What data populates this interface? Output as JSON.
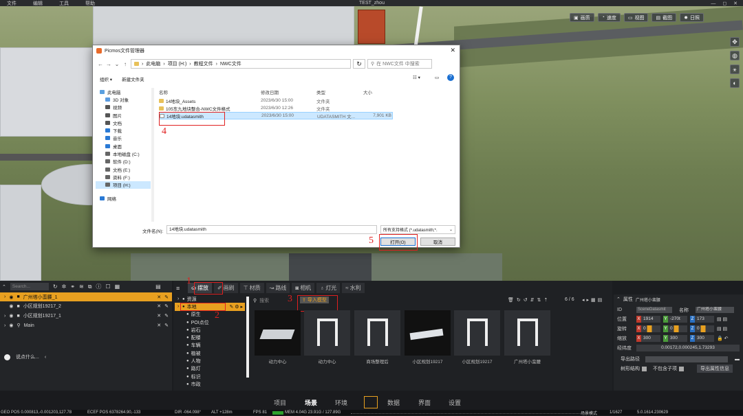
{
  "app": {
    "title": "TEST_zhou",
    "menu": [
      "文件",
      "编辑",
      "工具",
      "帮助"
    ]
  },
  "viewport": {
    "buttons": [
      "画质",
      "速度",
      "视图",
      "截图",
      "日照"
    ]
  },
  "dialog": {
    "title": "Picmos文件管理器",
    "path": [
      "此电脑",
      "项目 (H:)",
      "教程文件",
      "NWC文件"
    ],
    "search_placeholder": "在 NWC文件 中搜索",
    "organize": "组织 ▾",
    "new_folder": "新建文件夹",
    "nav": [
      {
        "label": "此电脑",
        "icon": "computer-icon"
      },
      {
        "label": "3D 对象",
        "icon": "cube-icon"
      },
      {
        "label": "视频",
        "icon": "video-icon"
      },
      {
        "label": "图片",
        "icon": "image-icon"
      },
      {
        "label": "文档",
        "icon": "document-icon"
      },
      {
        "label": "下载",
        "icon": "download-icon"
      },
      {
        "label": "音乐",
        "icon": "music-icon"
      },
      {
        "label": "桌面",
        "icon": "desktop-icon"
      },
      {
        "label": "本地磁盘 (C:)",
        "icon": "drive-icon"
      },
      {
        "label": "软件 (D:)",
        "icon": "drive-icon"
      },
      {
        "label": "文档 (E:)",
        "icon": "drive-icon"
      },
      {
        "label": "资料 (F:)",
        "icon": "drive-icon"
      },
      {
        "label": "项目 (H:)",
        "icon": "drive-icon"
      },
      {
        "label": "网络",
        "icon": "network-icon"
      }
    ],
    "columns": [
      "名称",
      "修改日期",
      "类型",
      "大小"
    ],
    "files": [
      {
        "name": "14地块_Assets",
        "date": "2023/6/30 15:00",
        "type": "文件夹",
        "size": "",
        "icon": "folder-icon"
      },
      {
        "name": "105东九地块整合-NWC文件格式",
        "date": "2023/6/30 12:26",
        "type": "文件夹",
        "size": "",
        "icon": "folder-icon"
      },
      {
        "name": "14地块.udatasmith",
        "date": "2023/6/30 15:00",
        "type": "UDATASMITH 文...",
        "size": "7,901 KB",
        "icon": "file-icon"
      }
    ],
    "filename_label": "文件名(N):",
    "filename_value": "14地块.udatasmith",
    "filetype": "所有支持格式 (*.udatasmith;*.",
    "open": "打开(O)",
    "cancel": "取消"
  },
  "annotations": [
    "1",
    "2",
    "3",
    "4",
    "5"
  ],
  "outliner": {
    "search_placeholder": "Search...",
    "items": [
      "广州塔小蛮腰_1",
      "小区规划19217_2",
      "小区规划19217_1",
      "Main"
    ],
    "chat": "说点什么..."
  },
  "tabs": [
    "摆放",
    "画刷",
    "材质",
    "路线",
    "相机",
    "灯光",
    "水利"
  ],
  "lib_tree": [
    "资源",
    "本地",
    "原生",
    "POI点位",
    "岩石",
    "配楼",
    "车辆",
    "植被",
    "人物",
    "路灯",
    "标识",
    "市政"
  ],
  "assets": {
    "search": "搜索",
    "import": "导入模型",
    "count": "6 / 6",
    "items": [
      "动力中心",
      "动力中心",
      "商场整理后",
      "小区规划19217",
      "小区规划19217",
      "广州塔小蛮腰"
    ]
  },
  "props": {
    "header": "属性",
    "object": "广州塔小蛮腰",
    "id_label": "ID",
    "id_value": "SceneDatasmit",
    "name_label": "名称",
    "name_value": "广州塔小蛮腰",
    "pos_label": "位置",
    "pos": [
      "1914",
      "-270t",
      "173"
    ],
    "rot_label": "旋转",
    "rot": [
      "0",
      "0",
      "0"
    ],
    "scale_label": "缩放",
    "scale": [
      "300",
      "300",
      "300"
    ],
    "geo_label": "经纬度",
    "geo_value": "0.00172,0.000245,1.73293",
    "export_path": "导出路径",
    "tree_struct": "树形结构",
    "no_child": "不包含子项",
    "export_btn": "导出属性信息"
  },
  "bottom_nav": [
    "项目",
    "场景",
    "环境",
    "数据",
    "界面",
    "设置"
  ],
  "status": {
    "geo": "GEO POS  0.000813,-0.001203,127.78",
    "ecef": "ECEF POS  6378264.90,-133",
    "dir": "DIR  -064.098°",
    "alt": "ALT  +128m",
    "fps": "FPS  81",
    "mem": "MEM  4.04G  23.91G / 127.89G",
    "mode": "场景模式",
    "page": "1/1627",
    "ver": "5.0.1614.230629"
  },
  "colors": {
    "accent": "#e8a020",
    "selection": "#cce8ff",
    "annotation": "#e02020"
  }
}
